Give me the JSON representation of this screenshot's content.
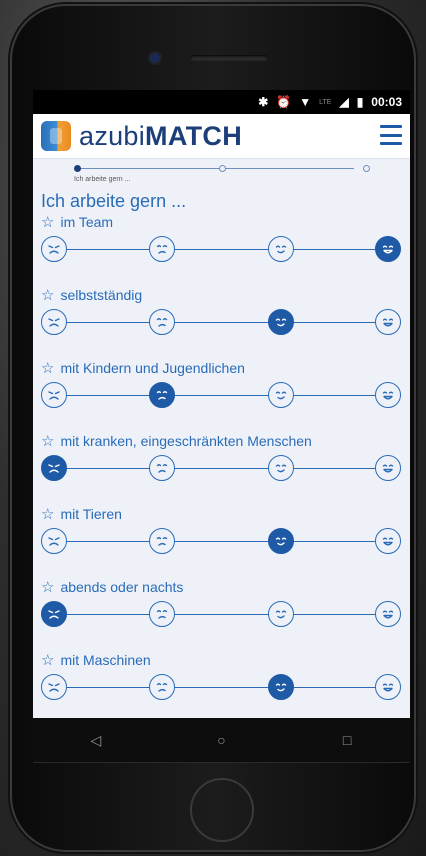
{
  "status": {
    "time": "00:03",
    "network": "LTE"
  },
  "app": {
    "brand_prefix": "azubi",
    "brand_suffix": "MATCH"
  },
  "progress": {
    "step_label": "Ich arbeite gern ...",
    "current_step": 1,
    "total_steps": 3
  },
  "page": {
    "heading": "Ich arbeite gern ..."
  },
  "scale_levels": [
    "very-unhappy",
    "unhappy",
    "happy",
    "very-happy"
  ],
  "items": [
    {
      "label": "im Team",
      "selected": 3
    },
    {
      "label": "selbstständig",
      "selected": 2
    },
    {
      "label": "mit Kindern und Jugendlichen",
      "selected": 1
    },
    {
      "label": "mit kranken, eingeschränkten Menschen",
      "selected": 0
    },
    {
      "label": "mit Tieren",
      "selected": 2
    },
    {
      "label": "abends oder nachts",
      "selected": 0
    },
    {
      "label": "mit Maschinen",
      "selected": 2
    }
  ],
  "nav": {
    "back": "◁",
    "home": "○",
    "recent": "□"
  },
  "colors": {
    "accent": "#2a6bb8",
    "brand": "#1c3f7a",
    "selected_fill": "#1f5aa6"
  }
}
